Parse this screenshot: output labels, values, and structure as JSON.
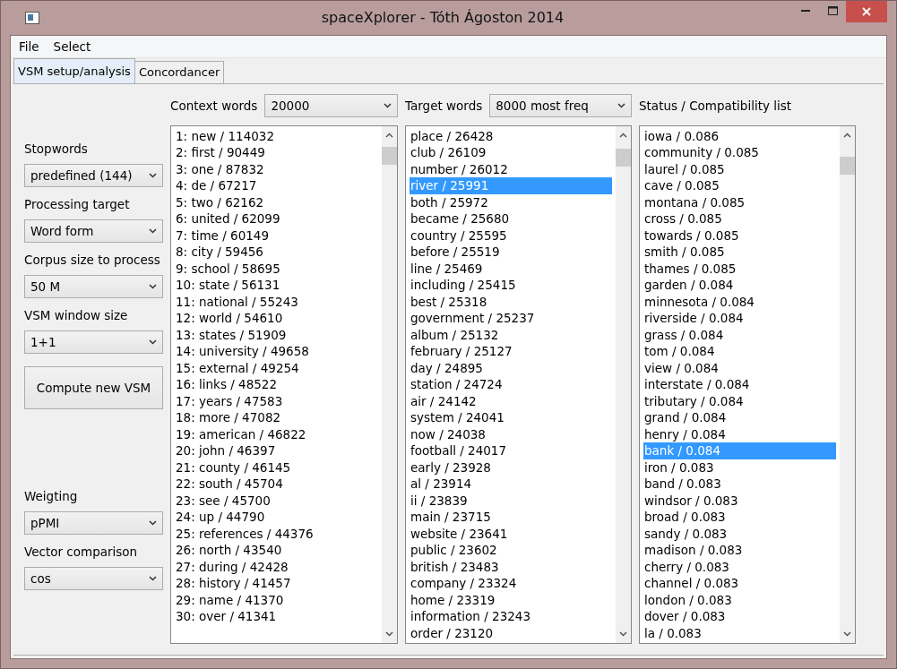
{
  "window": {
    "title": "spaceXplorer - Tóth Ágoston 2014"
  },
  "menu": [
    "File",
    "Select"
  ],
  "tabs": [
    {
      "label": "VSM setup/analysis",
      "selected": true
    },
    {
      "label": "Concordancer",
      "selected": false
    }
  ],
  "left_panel": {
    "top_settings": [
      {
        "label": "Stopwords",
        "value": "predefined (144)"
      },
      {
        "label": "Processing target",
        "value": "Word form"
      },
      {
        "label": "Corpus size to process",
        "value": "50 M"
      },
      {
        "label": "VSM window size",
        "value": "1+1"
      }
    ],
    "compute_button": "Compute new VSM",
    "bottom_settings": [
      {
        "label": "Weigting",
        "value": "pPMI"
      },
      {
        "label": "Vector comparison",
        "value": "cos"
      }
    ]
  },
  "lists": [
    {
      "label": "Context words",
      "dropdown": "20000",
      "items": [
        {
          "text": "1: new / 114032",
          "selected": false
        },
        {
          "text": "2: first / 90449",
          "selected": false
        },
        {
          "text": "3: one / 87832",
          "selected": false
        },
        {
          "text": "4: de / 67217",
          "selected": false
        },
        {
          "text": "5: two / 62162",
          "selected": false
        },
        {
          "text": "6: united / 62099",
          "selected": false
        },
        {
          "text": "7: time / 60149",
          "selected": false
        },
        {
          "text": "8: city / 59456",
          "selected": false
        },
        {
          "text": "9: school / 58695",
          "selected": false
        },
        {
          "text": "10: state / 56131",
          "selected": false
        },
        {
          "text": "11: national / 55243",
          "selected": false
        },
        {
          "text": "12: world / 54610",
          "selected": false
        },
        {
          "text": "13: states / 51909",
          "selected": false
        },
        {
          "text": "14: university / 49658",
          "selected": false
        },
        {
          "text": "15: external / 49254",
          "selected": false
        },
        {
          "text": "16: links / 48522",
          "selected": false
        },
        {
          "text": "17: years / 47583",
          "selected": false
        },
        {
          "text": "18: more / 47082",
          "selected": false
        },
        {
          "text": "19: american / 46822",
          "selected": false
        },
        {
          "text": "20: john / 46397",
          "selected": false
        },
        {
          "text": "21: county / 46145",
          "selected": false
        },
        {
          "text": "22: south / 45704",
          "selected": false
        },
        {
          "text": "23: see / 45700",
          "selected": false
        },
        {
          "text": "24: up / 44790",
          "selected": false
        },
        {
          "text": "25: references / 44376",
          "selected": false
        },
        {
          "text": "26: north / 43540",
          "selected": false
        },
        {
          "text": "27: during / 42428",
          "selected": false
        },
        {
          "text": "28: history / 41457",
          "selected": false
        },
        {
          "text": "29: name / 41370",
          "selected": false
        },
        {
          "text": "30: over / 41341",
          "selected": false
        }
      ]
    },
    {
      "label": "Target words",
      "dropdown": "8000 most freq",
      "items": [
        {
          "text": "place / 26428",
          "selected": false
        },
        {
          "text": "club / 26109",
          "selected": false
        },
        {
          "text": "number / 26012",
          "selected": false
        },
        {
          "text": "river / 25991",
          "selected": true
        },
        {
          "text": "both / 25972",
          "selected": false
        },
        {
          "text": "became / 25680",
          "selected": false
        },
        {
          "text": "country / 25595",
          "selected": false
        },
        {
          "text": "before / 25519",
          "selected": false
        },
        {
          "text": "line / 25469",
          "selected": false
        },
        {
          "text": "including / 25415",
          "selected": false
        },
        {
          "text": "best / 25318",
          "selected": false
        },
        {
          "text": "government / 25237",
          "selected": false
        },
        {
          "text": "album / 25132",
          "selected": false
        },
        {
          "text": "february / 25127",
          "selected": false
        },
        {
          "text": "day / 24895",
          "selected": false
        },
        {
          "text": "station / 24724",
          "selected": false
        },
        {
          "text": "air / 24142",
          "selected": false
        },
        {
          "text": "system / 24041",
          "selected": false
        },
        {
          "text": "now / 24038",
          "selected": false
        },
        {
          "text": "football / 24017",
          "selected": false
        },
        {
          "text": "early / 23928",
          "selected": false
        },
        {
          "text": "al / 23914",
          "selected": false
        },
        {
          "text": "ii / 23839",
          "selected": false
        },
        {
          "text": "main / 23715",
          "selected": false
        },
        {
          "text": "website / 23641",
          "selected": false
        },
        {
          "text": "public / 23602",
          "selected": false
        },
        {
          "text": "british / 23483",
          "selected": false
        },
        {
          "text": "company / 23324",
          "selected": false
        },
        {
          "text": "home / 23319",
          "selected": false
        },
        {
          "text": "information / 23243",
          "selected": false
        },
        {
          "text": "order / 23120",
          "selected": false
        }
      ]
    },
    {
      "label": "Status / Compatibility list",
      "items": [
        {
          "text": "iowa / 0.086",
          "selected": false
        },
        {
          "text": "community / 0.085",
          "selected": false
        },
        {
          "text": "laurel / 0.085",
          "selected": false
        },
        {
          "text": "cave / 0.085",
          "selected": false
        },
        {
          "text": "montana / 0.085",
          "selected": false
        },
        {
          "text": "cross / 0.085",
          "selected": false
        },
        {
          "text": "towards / 0.085",
          "selected": false
        },
        {
          "text": "smith / 0.085",
          "selected": false
        },
        {
          "text": "thames / 0.085",
          "selected": false
        },
        {
          "text": "garden / 0.084",
          "selected": false
        },
        {
          "text": "minnesota / 0.084",
          "selected": false
        },
        {
          "text": "riverside / 0.084",
          "selected": false
        },
        {
          "text": "grass / 0.084",
          "selected": false
        },
        {
          "text": "tom / 0.084",
          "selected": false
        },
        {
          "text": "view / 0.084",
          "selected": false
        },
        {
          "text": "interstate / 0.084",
          "selected": false
        },
        {
          "text": "tributary / 0.084",
          "selected": false
        },
        {
          "text": "grand / 0.084",
          "selected": false
        },
        {
          "text": "henry / 0.084",
          "selected": false
        },
        {
          "text": "bank / 0.084",
          "selected": true
        },
        {
          "text": "iron / 0.083",
          "selected": false
        },
        {
          "text": "band / 0.083",
          "selected": false
        },
        {
          "text": "windsor / 0.083",
          "selected": false
        },
        {
          "text": "broad / 0.083",
          "selected": false
        },
        {
          "text": "sandy / 0.083",
          "selected": false
        },
        {
          "text": "madison / 0.083",
          "selected": false
        },
        {
          "text": "cherry / 0.083",
          "selected": false
        },
        {
          "text": "channel / 0.083",
          "selected": false
        },
        {
          "text": "london / 0.083",
          "selected": false
        },
        {
          "text": "dover / 0.083",
          "selected": false
        },
        {
          "text": "la / 0.083",
          "selected": false
        }
      ]
    }
  ]
}
